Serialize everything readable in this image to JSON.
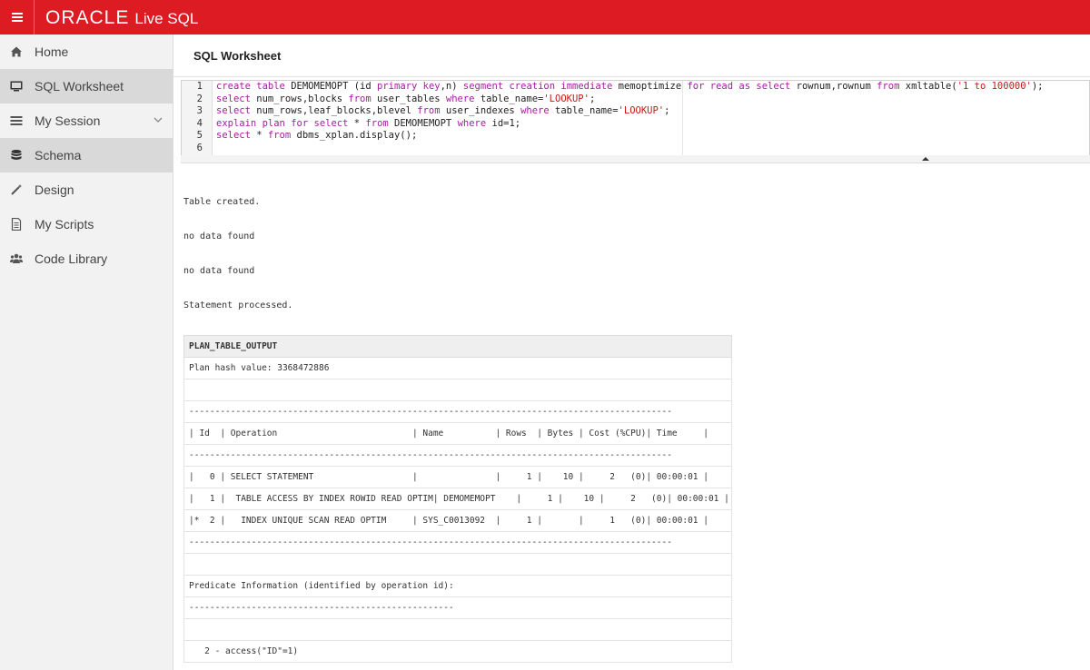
{
  "topbar": {
    "logo_text": "ORACLE",
    "product_text": "Live SQL",
    "menu_icon": "hamburger-icon",
    "brand_color": "#dc1c22"
  },
  "sidebar": {
    "items": [
      {
        "label": "Home",
        "icon": "home-icon"
      },
      {
        "label": "SQL Worksheet",
        "icon": "monitor-icon"
      },
      {
        "label": "My Session",
        "icon": "list-icon"
      },
      {
        "label": "Schema",
        "icon": "database-icon"
      },
      {
        "label": "Design",
        "icon": "wand-icon"
      },
      {
        "label": "My Scripts",
        "icon": "document-icon"
      },
      {
        "label": "Code Library",
        "icon": "users-icon"
      }
    ]
  },
  "main": {
    "title": "SQL Worksheet"
  },
  "editor": {
    "line_numbers": [
      "1",
      "2",
      "3",
      "4",
      "5",
      "6"
    ],
    "lines": [
      "create table DEMOMEMOPT (id primary key,n) segment creation immediate memoptimize for read as select rownum,rownum from xmltable('1 to 100000');",
      "select num_rows,blocks from user_tables where table_name='LOOKUP';",
      "select num_rows,leaf_blocks,blevel from user_indexes where table_name='LOOKUP';",
      "explain plan for select * from DEMOMEMOPT where id=1;",
      "select * from dbms_xplan.display();",
      ""
    ]
  },
  "results": {
    "messages": [
      "Table created.",
      "no data found",
      "no data found",
      "Statement processed."
    ],
    "plan_header": "PLAN_TABLE_OUTPUT",
    "plan_rows": [
      "Plan hash value: 3368472886",
      "",
      "---------------------------------------------------------------------------------------------",
      "| Id  | Operation                          | Name          | Rows  | Bytes | Cost (%CPU)| Time     |",
      "---------------------------------------------------------------------------------------------",
      "|   0 | SELECT STATEMENT                   |               |     1 |    10 |     2   (0)| 00:00:01 |",
      "|   1 |  TABLE ACCESS BY INDEX ROWID READ OPTIM| DEMOMEMOPT    |     1 |    10 |     2   (0)| 00:00:01 |",
      "|*  2 |   INDEX UNIQUE SCAN READ OPTIM     | SYS_C0013092  |     1 |       |     1   (0)| 00:00:01 |",
      "---------------------------------------------------------------------------------------------",
      "",
      "Predicate Information (identified by operation id):",
      "---------------------------------------------------",
      "",
      "   2 - access(\"ID\"=1)"
    ]
  }
}
